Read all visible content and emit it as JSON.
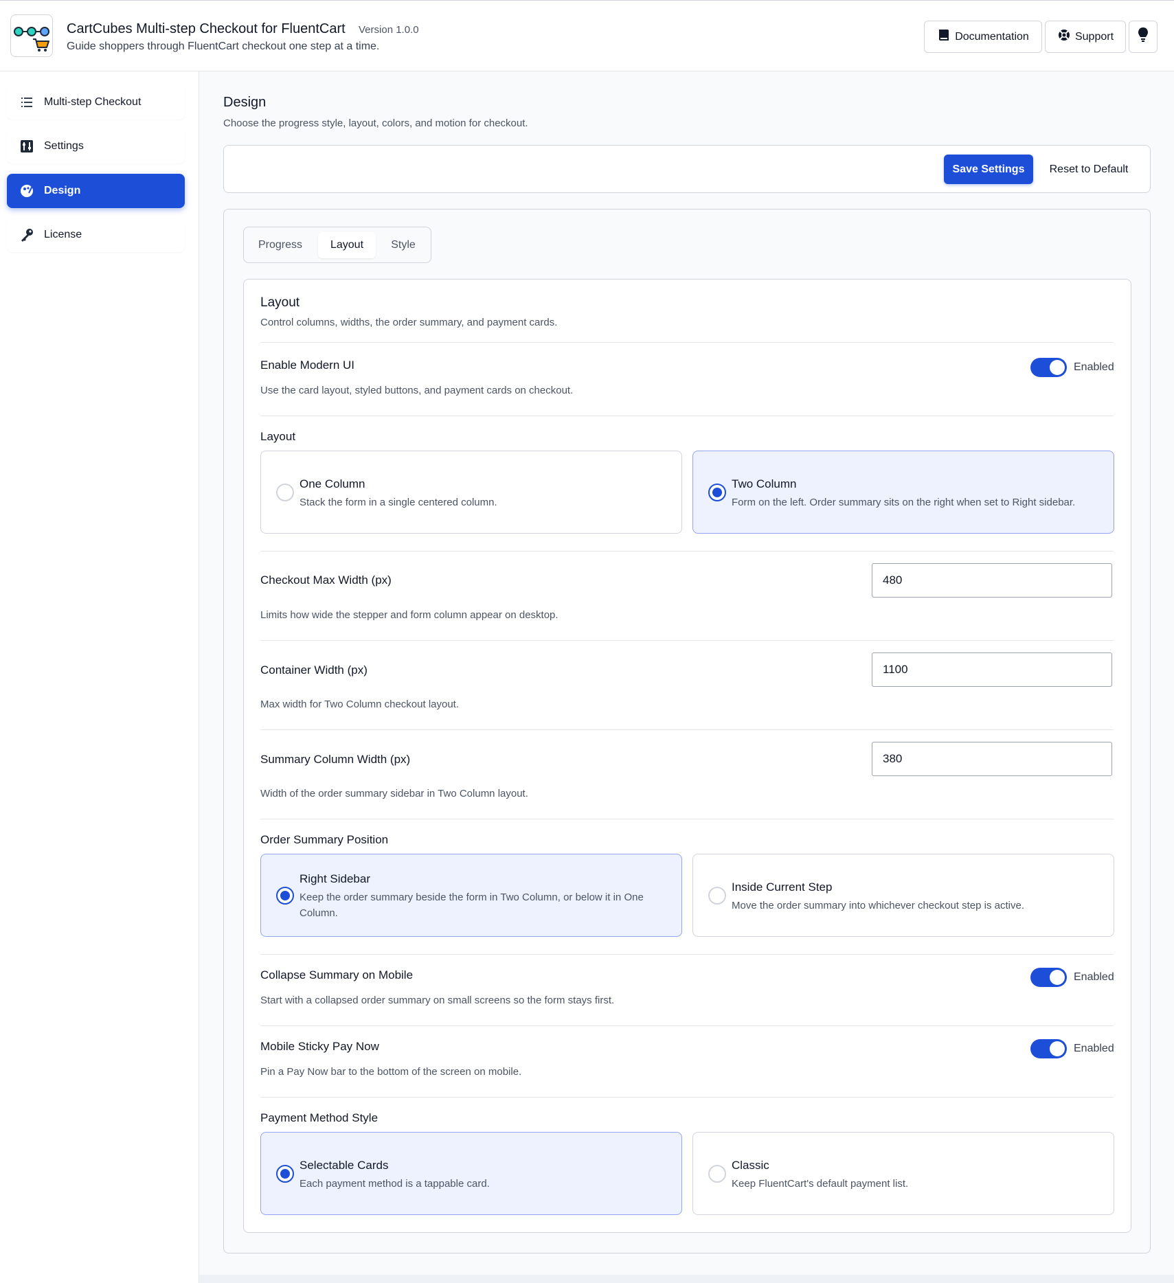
{
  "header": {
    "title": "CartCubes Multi-step Checkout for FluentCart",
    "version": "Version 1.0.0",
    "tagline": "Guide shoppers through FluentCart checkout one step at a time.",
    "documentation_label": "Documentation",
    "support_label": "Support"
  },
  "sidebar": {
    "items": [
      {
        "label": "Multi-step Checkout"
      },
      {
        "label": "Settings"
      },
      {
        "label": "Design"
      },
      {
        "label": "License"
      }
    ]
  },
  "page": {
    "title": "Design",
    "subtitle": "Choose the progress style, layout, colors, and motion for checkout.",
    "save_label": "Save Settings",
    "reset_label": "Reset to Default"
  },
  "tabs": [
    {
      "label": "Progress"
    },
    {
      "label": "Layout"
    },
    {
      "label": "Style"
    }
  ],
  "layout_section": {
    "title": "Layout",
    "subtitle": "Control columns, widths, the order summary, and payment cards.",
    "modern_ui": {
      "label": "Enable Modern UI",
      "description": "Use the card layout, styled buttons, and payment cards on checkout.",
      "status": "Enabled"
    },
    "layout": {
      "label": "Layout",
      "options": [
        {
          "title": "One Column",
          "description": "Stack the form in a single centered column."
        },
        {
          "title": "Two Column",
          "description": "Form on the left. Order summary sits on the right when set to Right sidebar."
        }
      ]
    },
    "checkout_max_width": {
      "label": "Checkout Max Width (px)",
      "value": "480",
      "description": "Limits how wide the stepper and form column appear on desktop."
    },
    "container_width": {
      "label": "Container Width (px)",
      "value": "1100",
      "description": "Max width for Two Column checkout layout."
    },
    "summary_column_width": {
      "label": "Summary Column Width (px)",
      "value": "380",
      "description": "Width of the order summary sidebar in Two Column layout."
    },
    "order_summary_position": {
      "label": "Order Summary Position",
      "options": [
        {
          "title": "Right Sidebar",
          "description": "Keep the order summary beside the form in Two Column, or below it in One Column."
        },
        {
          "title": "Inside Current Step",
          "description": "Move the order summary into whichever checkout step is active."
        }
      ]
    },
    "collapse_summary": {
      "label": "Collapse Summary on Mobile",
      "description": "Start with a collapsed order summary on small screens so the form stays first.",
      "status": "Enabled"
    },
    "sticky_pay_now": {
      "label": "Mobile Sticky Pay Now",
      "description": "Pin a Pay Now bar to the bottom of the screen on mobile.",
      "status": "Enabled"
    },
    "payment_method_style": {
      "label": "Payment Method Style",
      "options": [
        {
          "title": "Selectable Cards",
          "description": "Each payment method is a tappable card."
        },
        {
          "title": "Classic",
          "description": "Keep FluentCart's default payment list."
        }
      ]
    }
  },
  "colors": {
    "accent": "#1d4ed8",
    "selected_card_bg": "#eef2ff"
  }
}
